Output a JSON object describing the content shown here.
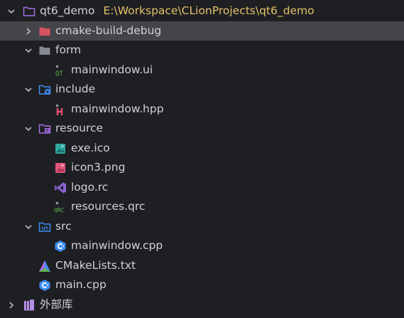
{
  "project_tree": {
    "root": {
      "name": "qt6_demo",
      "path": "E:\\Workspace\\CLionProjects\\qt6_demo",
      "expanded": true
    },
    "items": [
      {
        "name": "cmake-build-debug",
        "type": "folder-excluded",
        "expanded": false,
        "selected": true,
        "icon": "folder-icon"
      },
      {
        "name": "form",
        "type": "folder",
        "expanded": true,
        "icon": "folder-icon"
      },
      {
        "name": "mainwindow.ui",
        "type": "file",
        "icon": "qt-ui-file-icon"
      },
      {
        "name": "include",
        "type": "folder-include",
        "expanded": true,
        "icon": "include-folder-icon"
      },
      {
        "name": "mainwindow.hpp",
        "type": "file",
        "icon": "hpp-file-icon"
      },
      {
        "name": "resource",
        "type": "folder-resource",
        "expanded": true,
        "icon": "resource-folder-icon"
      },
      {
        "name": "exe.ico",
        "type": "file",
        "icon": "ico-file-icon"
      },
      {
        "name": "icon3.png",
        "type": "file",
        "icon": "png-file-icon"
      },
      {
        "name": "logo.rc",
        "type": "file",
        "icon": "rc-file-icon"
      },
      {
        "name": "resources.qrc",
        "type": "file",
        "icon": "qrc-file-icon"
      },
      {
        "name": "src",
        "type": "folder-source",
        "expanded": true,
        "icon": "source-folder-icon"
      },
      {
        "name": "mainwindow.cpp",
        "type": "file",
        "icon": "cpp-file-icon"
      },
      {
        "name": "CMakeLists.txt",
        "type": "file",
        "icon": "cmake-file-icon"
      },
      {
        "name": "main.cpp",
        "type": "file",
        "icon": "cpp-file-icon"
      }
    ],
    "external_libraries": {
      "name": "外部库",
      "expanded": false,
      "icon": "library-icon"
    }
  },
  "colors": {
    "background": "#1e1f22",
    "selection": "#43454a",
    "text": "#cfd1d6",
    "path_text": "#e4c16b",
    "excluded_folder": "#d7525e",
    "folder_gray": "#868991",
    "blue": "#3d8ef5",
    "purple": "#a16ee3",
    "qt_green": "#5fb84a",
    "teal": "#2fa7a0",
    "pink": "#e0567a"
  }
}
